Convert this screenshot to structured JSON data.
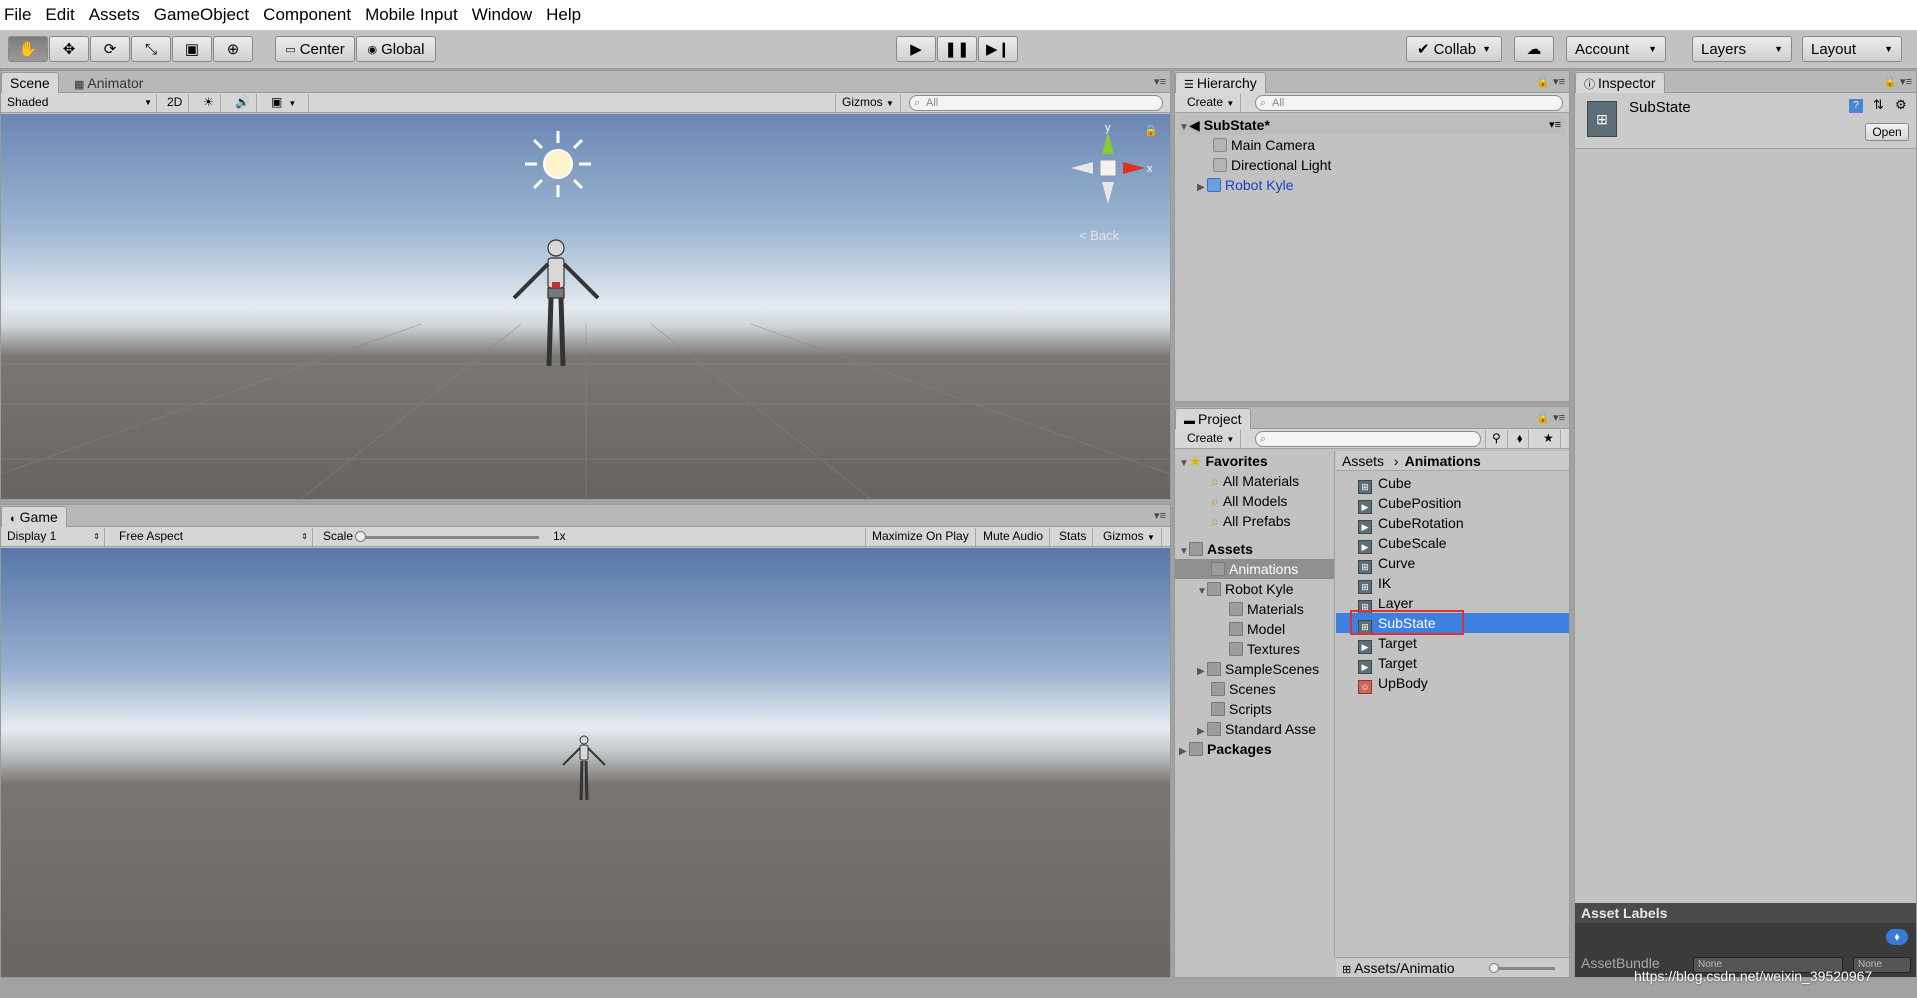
{
  "menu": [
    "File",
    "Edit",
    "Assets",
    "GameObject",
    "Component",
    "Mobile Input",
    "Window",
    "Help"
  ],
  "toolbar": {
    "pivot": "Center",
    "space": "Global",
    "collab": "Collab",
    "account": "Account",
    "layers": "Layers",
    "layout": "Layout"
  },
  "scene": {
    "tab_scene": "Scene",
    "tab_animator": "Animator",
    "shading": "Shaded",
    "mode_2d": "2D",
    "gizmos": "Gizmos",
    "search_placeholder": "All",
    "axis_y": "y",
    "axis_x": "x",
    "view_label": "< Back"
  },
  "game": {
    "tab": "Game",
    "display": "Display 1",
    "aspect": "Free Aspect",
    "scale_label": "Scale",
    "scale_value": "1x",
    "maximize": "Maximize On Play",
    "mute": "Mute Audio",
    "stats": "Stats",
    "gizmos": "Gizmos"
  },
  "hierarchy": {
    "tab": "Hierarchy",
    "create": "Create",
    "search_placeholder": "All",
    "scene_name": "SubState*",
    "items": [
      "Main Camera",
      "Directional Light",
      "Robot Kyle"
    ]
  },
  "project": {
    "tab": "Project",
    "create": "Create",
    "favorites": "Favorites",
    "favorite_items": [
      "All Materials",
      "All Models",
      "All Prefabs"
    ],
    "assets": "Assets",
    "folders": [
      "Animations",
      "Robot Kyle",
      "Materials",
      "Model",
      "Textures",
      "SampleScenes",
      "Scenes",
      "Scripts",
      "Standard Asse"
    ],
    "packages": "Packages",
    "breadcrumb_root": "Assets",
    "breadcrumb_current": "Animations",
    "files": [
      "Cube",
      "CubePosition",
      "CubeRotation",
      "CubeScale",
      "Curve",
      "IK",
      "Layer",
      "SubState",
      "Target",
      "Target",
      "UpBody"
    ],
    "selected_file": "SubState",
    "footer_path": "Assets/Animatio"
  },
  "inspector": {
    "tab": "Inspector",
    "object_name": "SubState",
    "open_button": "Open",
    "asset_labels": "Asset Labels",
    "asset_bundle": "AssetBundle",
    "bundle_value": "None",
    "bundle_variant": "None"
  },
  "watermark": "https://blog.csdn.net/weixin_39520967",
  "colors": {
    "selection": "#3d80df",
    "highlight_box": "#e03030",
    "link_blue": "#1a3fc4"
  }
}
